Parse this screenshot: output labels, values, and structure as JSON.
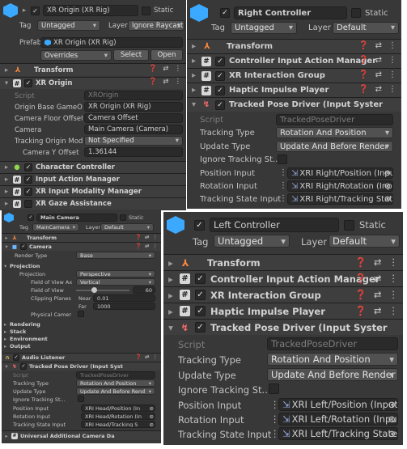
{
  "xr_origin_panel": {
    "object_name": "XR Origin (XR Rig)",
    "static_label": "Static",
    "tag_label": "Tag",
    "tag_value": "Untagged",
    "layer_label": "Layer",
    "layer_value": "Ignore Raycast",
    "prefab_label": "Prefab",
    "prefab_value": "XR Origin (XR Rig)",
    "overrides_label": "Overrides",
    "select_label": "Select",
    "open_label": "Open",
    "transform_label": "Transform",
    "component_label": "XR Origin",
    "fields": [
      {
        "label": "Script",
        "value": "XROrigin"
      },
      {
        "label": "Origin Base GameObj",
        "value": "XR Origin (XR Rig)"
      },
      {
        "label": "Camera Floor Offset O",
        "value": "Camera Offset"
      },
      {
        "label": "Camera",
        "value": "Main Camera (Camera)"
      },
      {
        "label": "Tracking Origin Mode",
        "value": "Not Specified"
      },
      {
        "label": "Camera Y Offset",
        "value": "1.36144"
      }
    ],
    "components": [
      "Character Controller",
      "Input Action Manager",
      "XR Input Modality Manager",
      "XR Gaze Assistance"
    ]
  },
  "right_controller_panel": {
    "object_name": "Right Controller",
    "static_label": "Static",
    "tag_label": "Tag",
    "tag_value": "Untagged",
    "layer_label": "Layer",
    "layer_value": "Default",
    "transform_label": "Transform",
    "components": [
      "Controller Input Action Manager",
      "XR Interaction Group",
      "Haptic Impulse Player"
    ],
    "tpd_label": "Tracked Pose Driver (Input Syster",
    "fields": [
      {
        "label": "Script",
        "value": "TrackedPoseDriver"
      },
      {
        "label": "Tracking Type",
        "value": "Rotation And Position"
      },
      {
        "label": "Update Type",
        "value": "Update And Before Render"
      },
      {
        "label": "Ignore Tracking St...",
        "value": ""
      },
      {
        "label": "Position Input",
        "value": "XRI Right/Position (Inpu"
      },
      {
        "label": "Rotation Input",
        "value": "XRI Right/Rotation (Inpu"
      },
      {
        "label": "Tracking State Input",
        "value": "XRI Right/Tracking Stat"
      }
    ]
  },
  "main_camera_panel": {
    "object_name": "Main Camera",
    "static_label": "Static",
    "tag_label": "Tag",
    "tag_value": "MainCamera",
    "layer_label": "Layer",
    "layer_value": "Default",
    "transform_label": "Transform",
    "camera_label": "Camera",
    "render_type_label": "Render Type",
    "render_type_value": "Base",
    "projection_section": "Projection",
    "projection_label": "Projection",
    "projection_value": "Perspective",
    "fov_axis_label": "Field of View Ax",
    "fov_axis_value": "Vertical",
    "fov_label": "Field of View",
    "fov_value": "60",
    "fov_fraction": 0.33,
    "clipping_label": "Clipping Planes",
    "near_label": "Near",
    "near_value": "0.01",
    "far_label": "Far",
    "far_value": "1000",
    "physical_label": "Physical Camer",
    "sections": [
      "Rendering",
      "Stack",
      "Environment",
      "Output"
    ],
    "audio_label": "Audio Listener",
    "tpd_label": "Tracked Pose Driver (Input Syst",
    "fields": [
      {
        "label": "Script",
        "value": "TrackedPoseDriver"
      },
      {
        "label": "Tracking Type",
        "value": "Rotation And Position"
      },
      {
        "label": "Update Type",
        "value": "Update And Before Rend"
      },
      {
        "label": "Ignore Tracking St...",
        "value": ""
      },
      {
        "label": "Position Input",
        "value": "XRI Head/Position (In"
      },
      {
        "label": "Rotation Input",
        "value": "XRI Head/Rotation (In"
      },
      {
        "label": "Tracking State Input",
        "value": "XRI Head/Tracking S"
      }
    ],
    "last_component": "Universal Additional Camera Da"
  },
  "left_controller_panel": {
    "object_name": "Left Controller",
    "static_label": "Static",
    "tag_label": "Tag",
    "tag_value": "Untagged",
    "layer_label": "Layer",
    "layer_value": "Default",
    "transform_label": "Transform",
    "components": [
      "Controller Input Action Manager",
      "XR Interaction Group",
      "Haptic Impulse Player"
    ],
    "tpd_label": "Tracked Pose Driver (Input Syster",
    "fields": [
      {
        "label": "Script",
        "value": "TrackedPoseDriver"
      },
      {
        "label": "Tracking Type",
        "value": "Rotation And Position"
      },
      {
        "label": "Update Type",
        "value": "Update And Before Render"
      },
      {
        "label": "Ignore Tracking St...",
        "value": ""
      },
      {
        "label": "Position Input",
        "value": "XRI Left/Position (Input"
      },
      {
        "label": "Rotation Input",
        "value": "XRI Left/Rotation (Input"
      },
      {
        "label": "Tracking State Input",
        "value": "XRI Left/Tracking State"
      }
    ]
  }
}
